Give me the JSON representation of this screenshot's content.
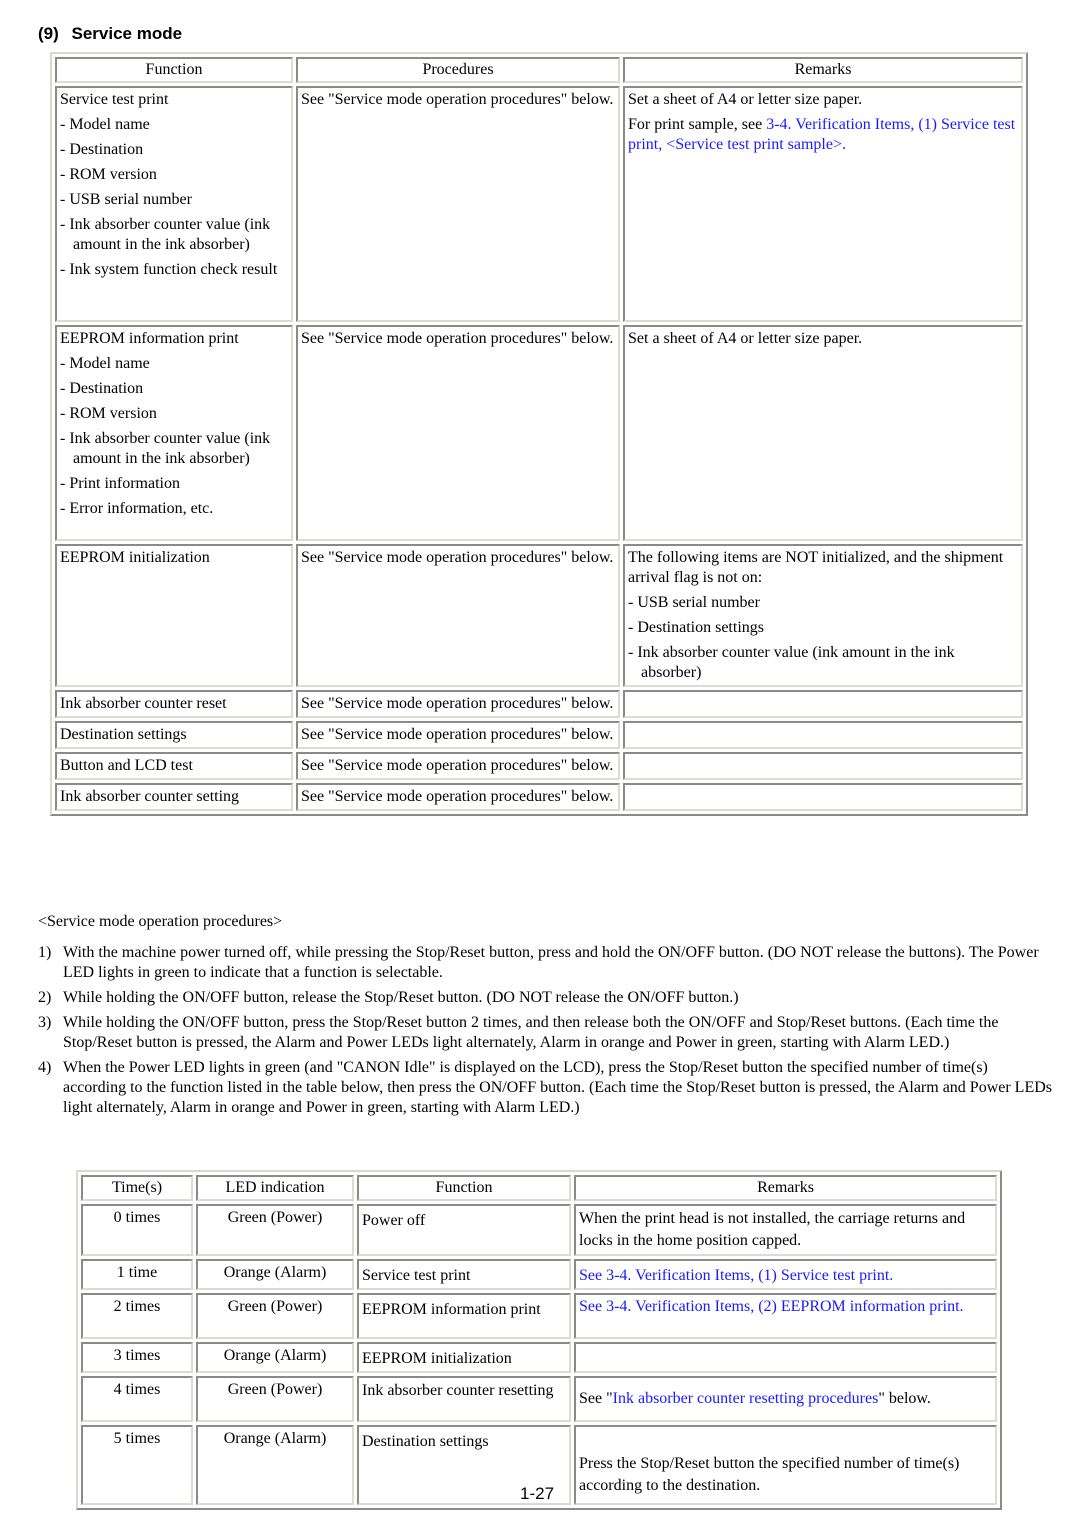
{
  "heading": {
    "number": "(9)",
    "title": "Service mode"
  },
  "table1": {
    "headers": [
      "Function",
      "Procedures",
      "Remarks"
    ],
    "rows": [
      {
        "function": "Service test print",
        "items": [
          "- Model name",
          "- Destination",
          "- ROM version",
          "- USB serial number",
          "- Ink absorber counter value (ink amount in the ink absorber)",
          "- Ink system function check result"
        ],
        "procedure": "See \"Service mode operation procedures\" below.",
        "remarks": "Set a sheet of A4 or letter size paper.",
        "remarks_prefix": "For print sample, see ",
        "remarks_link": "3-4. Verification Items, (1) Service test print, <Service test print sample>."
      },
      {
        "function": "EEPROM information print",
        "items": [
          "- Model name",
          "- Destination",
          "- ROM version",
          "- Ink absorber counter value (ink amount in the ink absorber)",
          "- Print information",
          "- Error information, etc."
        ],
        "procedure": "See \"Service mode operation procedures\" below.",
        "remarks": "Set a sheet of A4 or letter size paper."
      },
      {
        "function": "EEPROM initialization",
        "procedure": "See \"Service mode operation procedures\" below.",
        "remarks": "The following items are NOT initialized, and the shipment arrival flag is not on:",
        "remarks_items": [
          "- USB serial number",
          "- Destination settings",
          "- Ink absorber counter value (ink amount in the ink absorber)"
        ]
      },
      {
        "function": "Ink absorber counter reset",
        "procedure": "See \"Service mode operation procedures\" below.",
        "remarks": ""
      },
      {
        "function": "Destination settings",
        "procedure": "See \"Service mode operation procedures\" below.",
        "remarks": ""
      },
      {
        "function": "Button and LCD test",
        "procedure": "See \"Service mode operation procedures\" below.",
        "remarks": ""
      },
      {
        "function": "Ink absorber counter setting",
        "procedure": "See \"Service mode operation procedures\" below.",
        "remarks": ""
      }
    ]
  },
  "procedures": {
    "title": "<Service mode operation procedures>",
    "steps": [
      {
        "n": "1)",
        "text": "With the machine power turned off, while pressing the Stop/Reset button, press and hold the ON/OFF button. (DO NOT release the buttons). The Power LED lights in green to indicate that a function is selectable."
      },
      {
        "n": "2)",
        "text": "While holding the ON/OFF button, release the Stop/Reset button. (DO NOT release the ON/OFF button.)"
      },
      {
        "n": "3)",
        "text": "While holding the ON/OFF button, press the Stop/Reset button 2 times, and then release both the ON/OFF and Stop/Reset buttons. (Each time the Stop/Reset button is pressed, the Alarm and Power LEDs light alternately, Alarm in orange and Power in green, starting with Alarm LED.)"
      },
      {
        "n": "4)",
        "text": "When the Power LED lights in green (and \"CANON Idle\" is displayed on the LCD), press the Stop/Reset button the specified number of time(s) according to the function listed in the table below, then press the ON/OFF button. (Each time the Stop/Reset button is pressed, the Alarm and Power LEDs light alternately, Alarm in orange and Power in green, starting with Alarm LED.)"
      }
    ]
  },
  "table2": {
    "headers": [
      "Time(s)",
      "LED indication",
      "Function",
      "Remarks"
    ],
    "rows": [
      {
        "times": "0 times",
        "led": "Green (Power)",
        "function": "Power off",
        "remarks": "When the print head is not installed, the carriage returns and locks in the home position capped."
      },
      {
        "times": "1 time",
        "led": "Orange (Alarm)",
        "function": "Service test print",
        "remarks_link": "See 3-4. Verification Items, (1) Service test print."
      },
      {
        "times": "2 times",
        "led": "Green (Power)",
        "function": "EEPROM information print",
        "remarks_link": "See 3-4. Verification Items, (2) EEPROM information print."
      },
      {
        "times": "3 times",
        "led": "Orange (Alarm)",
        "function": "EEPROM initialization",
        "remarks": ""
      },
      {
        "times": "4 times",
        "led": "Green (Power)",
        "function": "Ink absorber counter resetting",
        "remarks_prefix": "See \"",
        "remarks_link": "Ink absorber counter resetting procedures",
        "remarks_suffix": "\" below."
      },
      {
        "times": "5 times",
        "led": "Orange (Alarm)",
        "function": "Destination settings",
        "remarks": "Press the Stop/Reset button the specified number of time(s) according to the destination."
      }
    ]
  },
  "page_number": "1-27",
  "colors": {
    "link": "#1a1aff",
    "text": "#000000"
  }
}
